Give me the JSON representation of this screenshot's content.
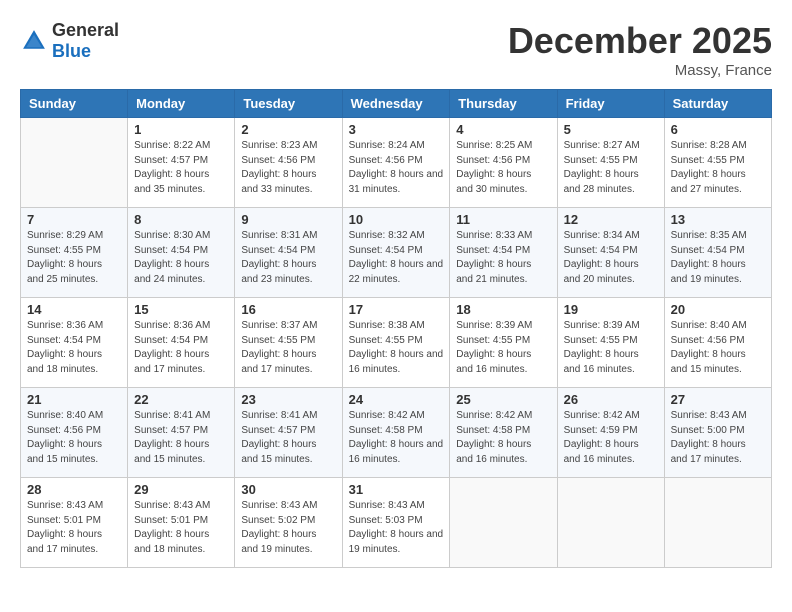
{
  "logo": {
    "general": "General",
    "blue": "Blue"
  },
  "title": "December 2025",
  "location": "Massy, France",
  "days_of_week": [
    "Sunday",
    "Monday",
    "Tuesday",
    "Wednesday",
    "Thursday",
    "Friday",
    "Saturday"
  ],
  "weeks": [
    [
      {
        "day": "",
        "sunrise": "",
        "sunset": "",
        "daylight": ""
      },
      {
        "day": "1",
        "sunrise": "Sunrise: 8:22 AM",
        "sunset": "Sunset: 4:57 PM",
        "daylight": "Daylight: 8 hours and 35 minutes."
      },
      {
        "day": "2",
        "sunrise": "Sunrise: 8:23 AM",
        "sunset": "Sunset: 4:56 PM",
        "daylight": "Daylight: 8 hours and 33 minutes."
      },
      {
        "day": "3",
        "sunrise": "Sunrise: 8:24 AM",
        "sunset": "Sunset: 4:56 PM",
        "daylight": "Daylight: 8 hours and 31 minutes."
      },
      {
        "day": "4",
        "sunrise": "Sunrise: 8:25 AM",
        "sunset": "Sunset: 4:56 PM",
        "daylight": "Daylight: 8 hours and 30 minutes."
      },
      {
        "day": "5",
        "sunrise": "Sunrise: 8:27 AM",
        "sunset": "Sunset: 4:55 PM",
        "daylight": "Daylight: 8 hours and 28 minutes."
      },
      {
        "day": "6",
        "sunrise": "Sunrise: 8:28 AM",
        "sunset": "Sunset: 4:55 PM",
        "daylight": "Daylight: 8 hours and 27 minutes."
      }
    ],
    [
      {
        "day": "7",
        "sunrise": "Sunrise: 8:29 AM",
        "sunset": "Sunset: 4:55 PM",
        "daylight": "Daylight: 8 hours and 25 minutes."
      },
      {
        "day": "8",
        "sunrise": "Sunrise: 8:30 AM",
        "sunset": "Sunset: 4:54 PM",
        "daylight": "Daylight: 8 hours and 24 minutes."
      },
      {
        "day": "9",
        "sunrise": "Sunrise: 8:31 AM",
        "sunset": "Sunset: 4:54 PM",
        "daylight": "Daylight: 8 hours and 23 minutes."
      },
      {
        "day": "10",
        "sunrise": "Sunrise: 8:32 AM",
        "sunset": "Sunset: 4:54 PM",
        "daylight": "Daylight: 8 hours and 22 minutes."
      },
      {
        "day": "11",
        "sunrise": "Sunrise: 8:33 AM",
        "sunset": "Sunset: 4:54 PM",
        "daylight": "Daylight: 8 hours and 21 minutes."
      },
      {
        "day": "12",
        "sunrise": "Sunrise: 8:34 AM",
        "sunset": "Sunset: 4:54 PM",
        "daylight": "Daylight: 8 hours and 20 minutes."
      },
      {
        "day": "13",
        "sunrise": "Sunrise: 8:35 AM",
        "sunset": "Sunset: 4:54 PM",
        "daylight": "Daylight: 8 hours and 19 minutes."
      }
    ],
    [
      {
        "day": "14",
        "sunrise": "Sunrise: 8:36 AM",
        "sunset": "Sunset: 4:54 PM",
        "daylight": "Daylight: 8 hours and 18 minutes."
      },
      {
        "day": "15",
        "sunrise": "Sunrise: 8:36 AM",
        "sunset": "Sunset: 4:54 PM",
        "daylight": "Daylight: 8 hours and 17 minutes."
      },
      {
        "day": "16",
        "sunrise": "Sunrise: 8:37 AM",
        "sunset": "Sunset: 4:55 PM",
        "daylight": "Daylight: 8 hours and 17 minutes."
      },
      {
        "day": "17",
        "sunrise": "Sunrise: 8:38 AM",
        "sunset": "Sunset: 4:55 PM",
        "daylight": "Daylight: 8 hours and 16 minutes."
      },
      {
        "day": "18",
        "sunrise": "Sunrise: 8:39 AM",
        "sunset": "Sunset: 4:55 PM",
        "daylight": "Daylight: 8 hours and 16 minutes."
      },
      {
        "day": "19",
        "sunrise": "Sunrise: 8:39 AM",
        "sunset": "Sunset: 4:55 PM",
        "daylight": "Daylight: 8 hours and 16 minutes."
      },
      {
        "day": "20",
        "sunrise": "Sunrise: 8:40 AM",
        "sunset": "Sunset: 4:56 PM",
        "daylight": "Daylight: 8 hours and 15 minutes."
      }
    ],
    [
      {
        "day": "21",
        "sunrise": "Sunrise: 8:40 AM",
        "sunset": "Sunset: 4:56 PM",
        "daylight": "Daylight: 8 hours and 15 minutes."
      },
      {
        "day": "22",
        "sunrise": "Sunrise: 8:41 AM",
        "sunset": "Sunset: 4:57 PM",
        "daylight": "Daylight: 8 hours and 15 minutes."
      },
      {
        "day": "23",
        "sunrise": "Sunrise: 8:41 AM",
        "sunset": "Sunset: 4:57 PM",
        "daylight": "Daylight: 8 hours and 15 minutes."
      },
      {
        "day": "24",
        "sunrise": "Sunrise: 8:42 AM",
        "sunset": "Sunset: 4:58 PM",
        "daylight": "Daylight: 8 hours and 16 minutes."
      },
      {
        "day": "25",
        "sunrise": "Sunrise: 8:42 AM",
        "sunset": "Sunset: 4:58 PM",
        "daylight": "Daylight: 8 hours and 16 minutes."
      },
      {
        "day": "26",
        "sunrise": "Sunrise: 8:42 AM",
        "sunset": "Sunset: 4:59 PM",
        "daylight": "Daylight: 8 hours and 16 minutes."
      },
      {
        "day": "27",
        "sunrise": "Sunrise: 8:43 AM",
        "sunset": "Sunset: 5:00 PM",
        "daylight": "Daylight: 8 hours and 17 minutes."
      }
    ],
    [
      {
        "day": "28",
        "sunrise": "Sunrise: 8:43 AM",
        "sunset": "Sunset: 5:01 PM",
        "daylight": "Daylight: 8 hours and 17 minutes."
      },
      {
        "day": "29",
        "sunrise": "Sunrise: 8:43 AM",
        "sunset": "Sunset: 5:01 PM",
        "daylight": "Daylight: 8 hours and 18 minutes."
      },
      {
        "day": "30",
        "sunrise": "Sunrise: 8:43 AM",
        "sunset": "Sunset: 5:02 PM",
        "daylight": "Daylight: 8 hours and 19 minutes."
      },
      {
        "day": "31",
        "sunrise": "Sunrise: 8:43 AM",
        "sunset": "Sunset: 5:03 PM",
        "daylight": "Daylight: 8 hours and 19 minutes."
      },
      {
        "day": "",
        "sunrise": "",
        "sunset": "",
        "daylight": ""
      },
      {
        "day": "",
        "sunrise": "",
        "sunset": "",
        "daylight": ""
      },
      {
        "day": "",
        "sunrise": "",
        "sunset": "",
        "daylight": ""
      }
    ]
  ]
}
